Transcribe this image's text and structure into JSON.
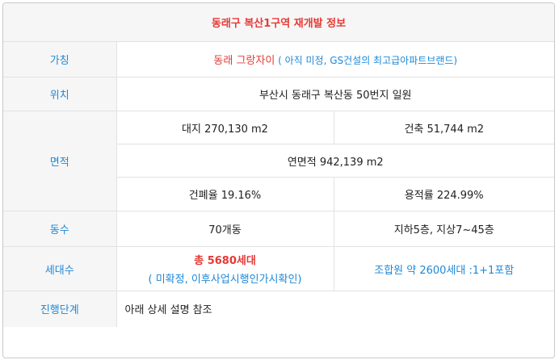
{
  "title": "동래구 복산1구역 재개발 정보",
  "rows": {
    "name": {
      "label": "가칭",
      "value_main": "동래 그랑자이",
      "value_note": " ( 아직 미정, GS건설의 최고급아파트브랜드)"
    },
    "location": {
      "label": "위치",
      "value": "부산시 동래구 복산동 50번지 일원"
    },
    "area": {
      "label": "면적",
      "land": "대지 270,130 m2",
      "building": "건축 51,744 m2",
      "floor_total": "연면적 942,139 m2",
      "coverage": "건폐율 19.16%",
      "far": "용적률 224.99%"
    },
    "buildings": {
      "label": "동수",
      "count": "70개동",
      "floors": "지하5층, 지상7~45층"
    },
    "households": {
      "label": "세대수",
      "total": "총 5680세대",
      "total_note": "( 미확정, 이후사업시행인가시확인)",
      "members": "조합원 약 2600세대 :1+1포함"
    },
    "progress": {
      "label": "진행단계",
      "value": "아래 상세 설명 참조"
    }
  },
  "colors": {
    "accent_red": "#e53935",
    "accent_blue": "#1e88d8",
    "label_bg": "#f6f6f6"
  }
}
